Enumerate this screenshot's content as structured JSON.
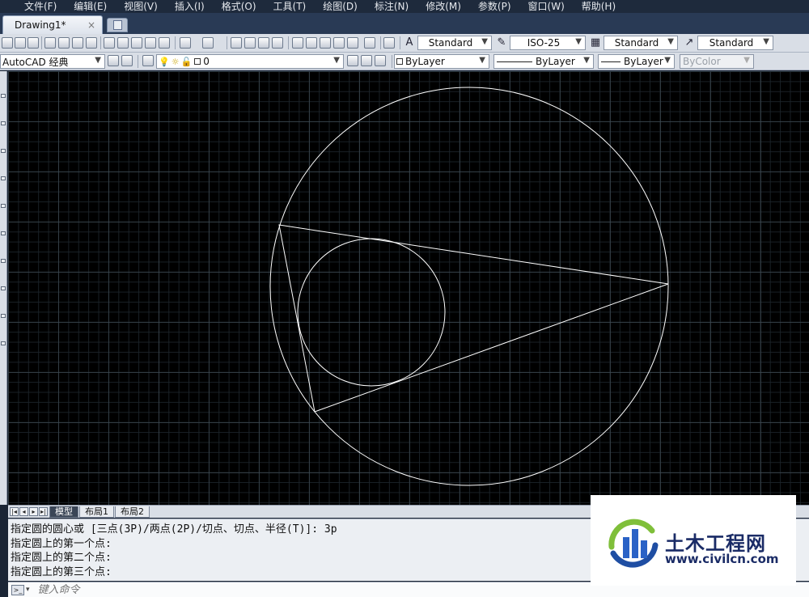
{
  "menu": [
    "文件(F)",
    "编辑(E)",
    "视图(V)",
    "插入(I)",
    "格式(O)",
    "工具(T)",
    "绘图(D)",
    "标注(N)",
    "修改(M)",
    "参数(P)",
    "窗口(W)",
    "帮助(H)"
  ],
  "document_tab": {
    "title": "Drawing1*",
    "close": "×"
  },
  "styles": {
    "text_style": "Standard",
    "dim_style": "ISO-25",
    "table_style": "Standard",
    "multileader_style": "Standard"
  },
  "workspace": "AutoCAD 经典",
  "layer": {
    "name": "0"
  },
  "properties": {
    "color": "ByLayer",
    "linetype": "ByLayer",
    "lineweight": "ByLayer",
    "plotstyle": "ByColor"
  },
  "layout_tabs": {
    "model": "模型",
    "layout1": "布局1",
    "layout2": "布局2"
  },
  "command_history": [
    "指定圆的圆心或 [三点(3P)/两点(2P)/切点、切点、半径(T)]: 3p",
    "指定圆上的第一个点:",
    "指定圆上的第二个点:",
    "指定圆上的第三个点:"
  ],
  "command_input_placeholder": "键入命令",
  "watermark": {
    "title": "土木工程网",
    "url": "www.civilcn.com"
  },
  "icons": [
    "new-file-icon",
    "open-icon",
    "save-icon",
    "print-icon",
    "undo-icon",
    "redo-icon",
    "pan-icon",
    "zoom-icon",
    "help-icon",
    "layer-icon",
    "lightbulb-icon"
  ],
  "colors": {
    "canvas": "#000000",
    "geometry": "#ffffff",
    "menubar": "#1e2a3c",
    "toolbar": "#d9dee6"
  }
}
